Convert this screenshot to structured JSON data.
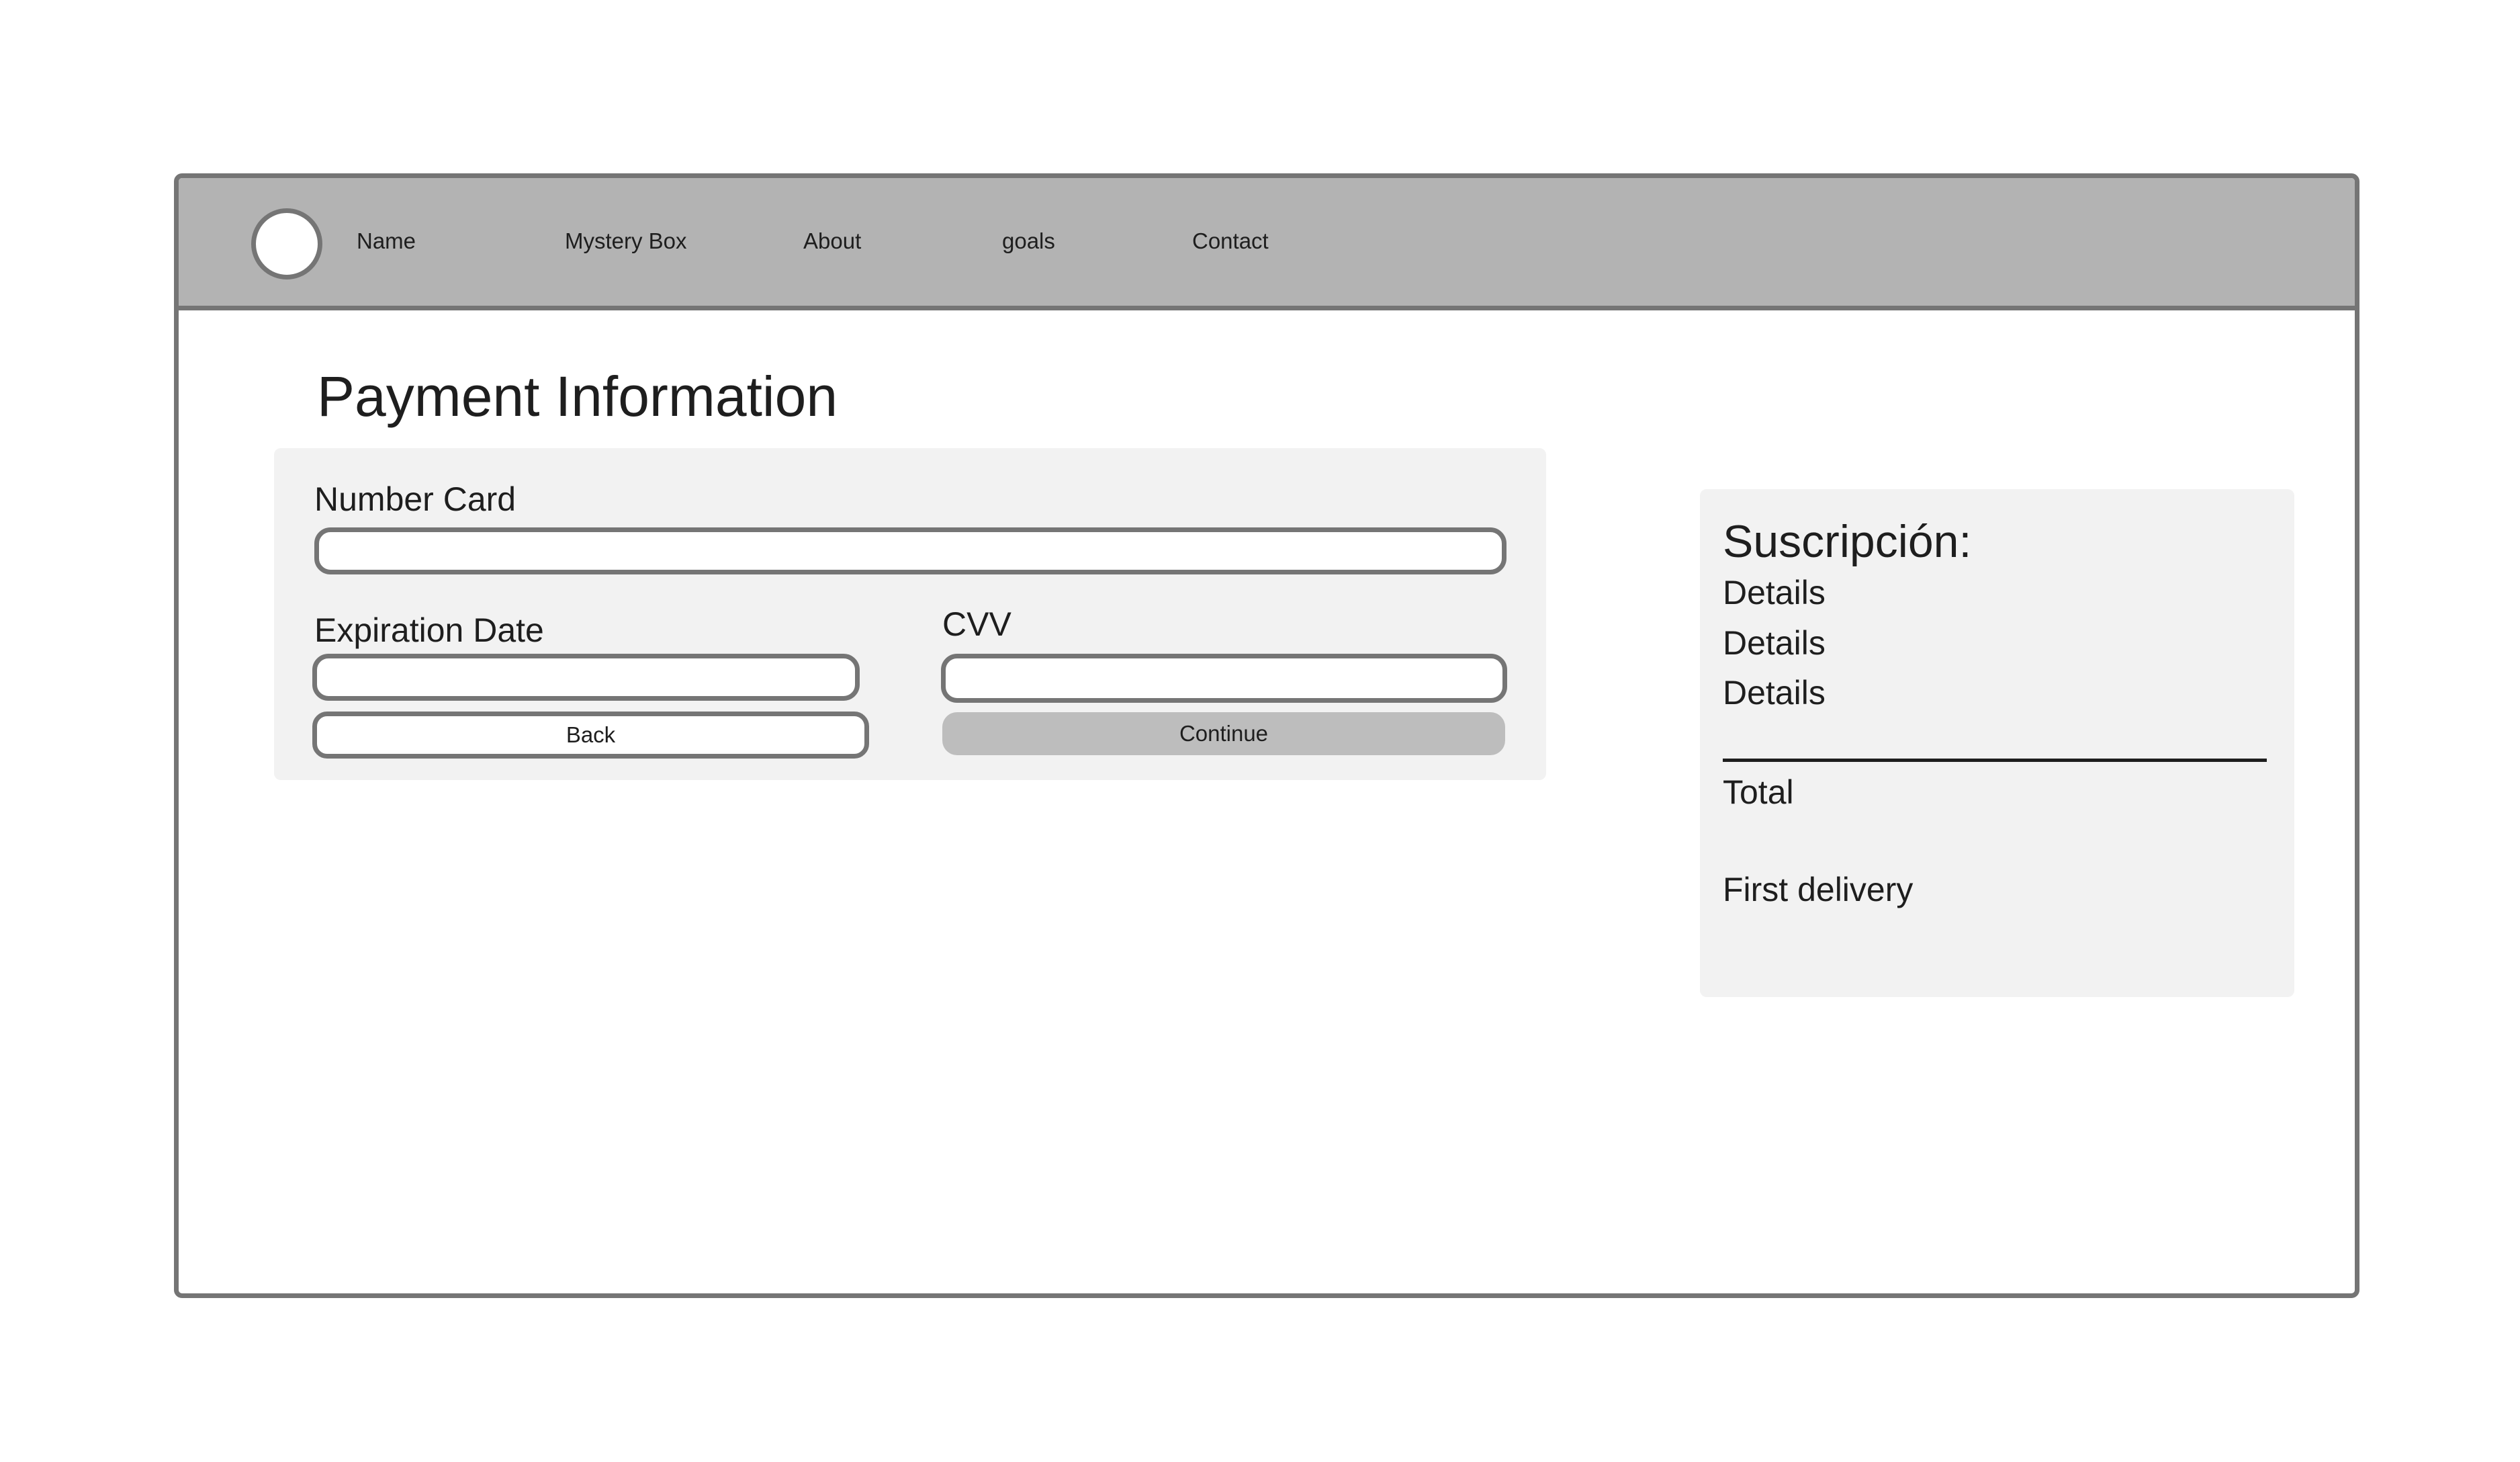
{
  "nav": {
    "items": [
      {
        "label": "Name"
      },
      {
        "label": "Mystery Box"
      },
      {
        "label": "About"
      },
      {
        "label": "goals"
      },
      {
        "label": "Contact"
      }
    ]
  },
  "page": {
    "title": "Payment Information"
  },
  "form": {
    "number_card_label": "Number Card",
    "number_card_value": "",
    "expiration_label": "Expiration Date",
    "expiration_value": "",
    "cvv_label": "CVV",
    "cvv_value": "",
    "back_label": "Back",
    "continue_label": "Continue"
  },
  "summary": {
    "title": "Suscripción:",
    "details": [
      "Details",
      "Details",
      "Details"
    ],
    "total_label": "Total",
    "first_delivery_label": "First delivery"
  },
  "colors": {
    "navbar_bg": "#b3b3b3",
    "border": "#757575",
    "panel_bg": "#f2f2f2",
    "continue_bg": "#bdbdbd",
    "text": "#1e1e1e"
  }
}
